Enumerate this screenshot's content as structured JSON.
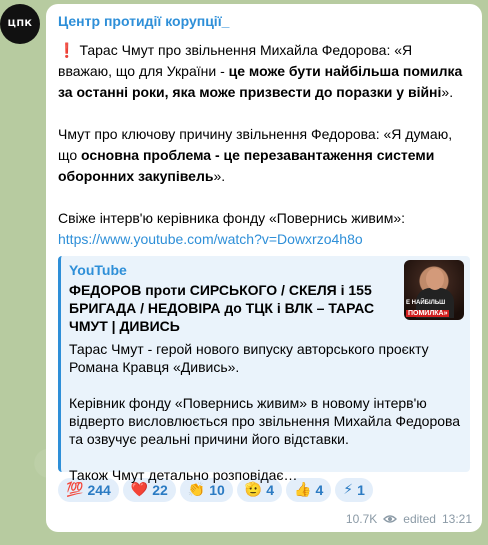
{
  "avatar_text": "ЦПК",
  "channel_name": "Центр протидії корупції_",
  "message": {
    "p1": {
      "excl": "❗",
      "pre": "Тарас Чмут про звільнення Михайла Федорова: «Я вважаю, що для України - ",
      "bold": "це може бути найбільша помилка за останні роки, яка може призвести до поразки у війні",
      "post": "»."
    },
    "p2": {
      "pre": "Чмут про ключову причину звільнення Федорова: «Я думаю, що ",
      "bold": "основна проблема - це перезавантаження системи оборонних закупівель",
      "post": "»."
    },
    "p3": "Свіже інтерв'ю керівника фонду «Повернись живим»:",
    "link": "https://www.youtube.com/watch?v=Dowxrzo4h8o"
  },
  "preview": {
    "site": "YouTube",
    "title": "ФЕДОРОВ проти СИРСЬКОГО / СКЕЛЯ і 155 БРИГАДА / НЕДОВІРА до ТЦК і ВЛК – ТАРАС ЧМУТ | ДИВИСЬ",
    "description": "Тарас Чмут - герой нового випуску авторського проєкту Романа Кравця «Дивись».\n\nКерівник фонду «Повернись живим» в новому інтерв'ю відверто висловлюється про звільнення Михайла Федорова та озвучує реальні причини його відставки.\n\nТакож Чмут детально розповідає…",
    "thumb_line1": "Е НАЙБІЛЬШ",
    "thumb_line2": "ПОМИЛКА»"
  },
  "reactions": [
    {
      "emoji": "💯",
      "count": "244"
    },
    {
      "emoji": "❤️",
      "count": "22"
    },
    {
      "emoji": "👏",
      "count": "10"
    },
    {
      "emoji": "🫡",
      "count": "4"
    },
    {
      "emoji": "👍",
      "count": "4"
    },
    {
      "emoji": "⚡",
      "count": "1"
    }
  ],
  "meta": {
    "views": "10.7K",
    "edited": "edited",
    "time": "13:21"
  },
  "colors": {
    "accent": "#2e8fd8",
    "background": "#b7cba0",
    "reaction_bg": "#e3eefa"
  }
}
